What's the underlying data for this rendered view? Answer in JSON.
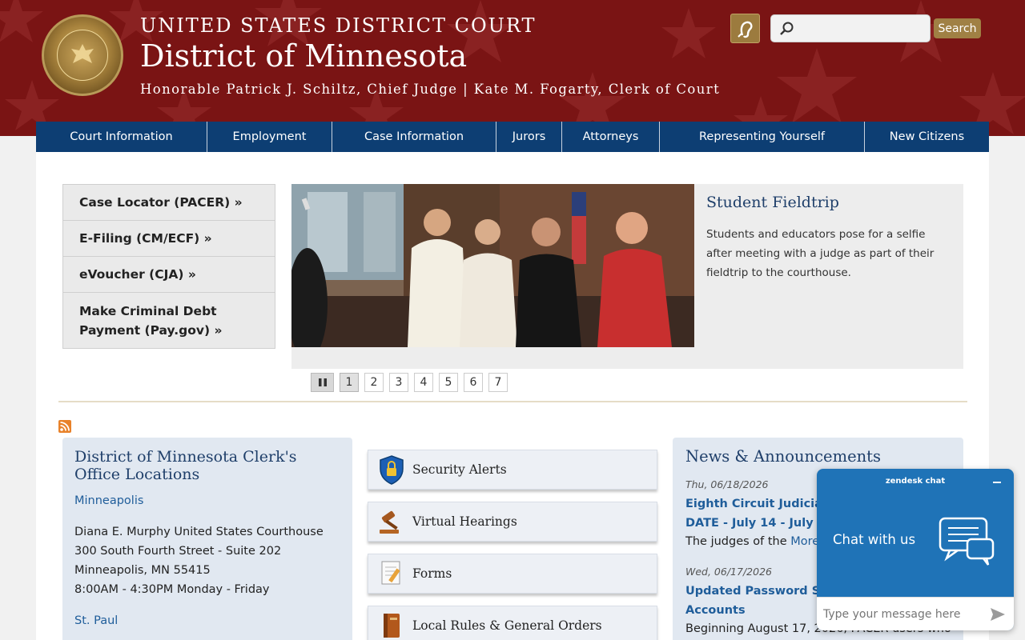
{
  "header": {
    "line1": "UNITED STATES DISTRICT COURT",
    "title": "District of Minnesota",
    "subtitle": "Honorable Patrick J. Schiltz, Chief Judge | Kate M. Fogarty, Clerk of Court",
    "seal_icon": "court-seal-icon",
    "accessibility_icon": "hearing-assist-icon",
    "search_placeholder": "",
    "search_button": "Search",
    "colors": {
      "banner": "#7a1414",
      "nav": "#0d3e73",
      "gold": "#a08044"
    }
  },
  "nav": [
    "Court Information",
    "Employment",
    "Case Information",
    "Jurors",
    "Attorneys",
    "Representing Yourself",
    "New Citizens"
  ],
  "quick_links": [
    "Case Locator (PACER) »",
    "E-Filing (CM/ECF) »",
    "eVoucher (CJA) »",
    "Make Criminal Debt Payment (Pay.gov) »"
  ],
  "slideshow": {
    "title": "Student Fieldtrip",
    "text": "Students and educators pose for a selfie after meeting with a judge as part of their fieldtrip to the courthouse.",
    "pages": [
      "1",
      "2",
      "3",
      "4",
      "5",
      "6",
      "7"
    ],
    "active_page": "1"
  },
  "locations": {
    "title": "District of Minnesota Clerk's Office Locations",
    "minneapolis": {
      "link": "Minneapolis",
      "building": "Diana E. Murphy United States Courthouse",
      "street": "300 South Fourth Street - Suite 202",
      "city": "Minneapolis, MN 55415",
      "hours": "8:00AM - 4:30PM Monday - Friday"
    },
    "st_paul_link": "St. Paul"
  },
  "tiles": [
    {
      "label": "Security Alerts",
      "icon": "shield-lock-icon"
    },
    {
      "label": "Virtual Hearings",
      "icon": "gavel-icon"
    },
    {
      "label": "Forms",
      "icon": "form-pencil-icon"
    },
    {
      "label": "Local Rules & General Orders",
      "icon": "book-icon"
    }
  ],
  "news": {
    "title": "News & Announcements",
    "items": [
      {
        "date": "Thu, 06/18/2026",
        "link1": "Eighth Circuit Judicial Co",
        "link2": "DATE - July 14 - July 16, 2",
        "text": "The judges of the ",
        "more": "More"
      },
      {
        "date": "Wed, 06/17/2026",
        "link1": "Updated Password Stan",
        "link2": "Accounts",
        "text": "Beginning August 17, 2026, PACER users who"
      }
    ]
  },
  "chat": {
    "brand": "zendesk chat",
    "heading": "Chat with us",
    "placeholder": "Type your message here",
    "minimize_icon": "minimize-icon",
    "send_icon": "send-icon"
  }
}
